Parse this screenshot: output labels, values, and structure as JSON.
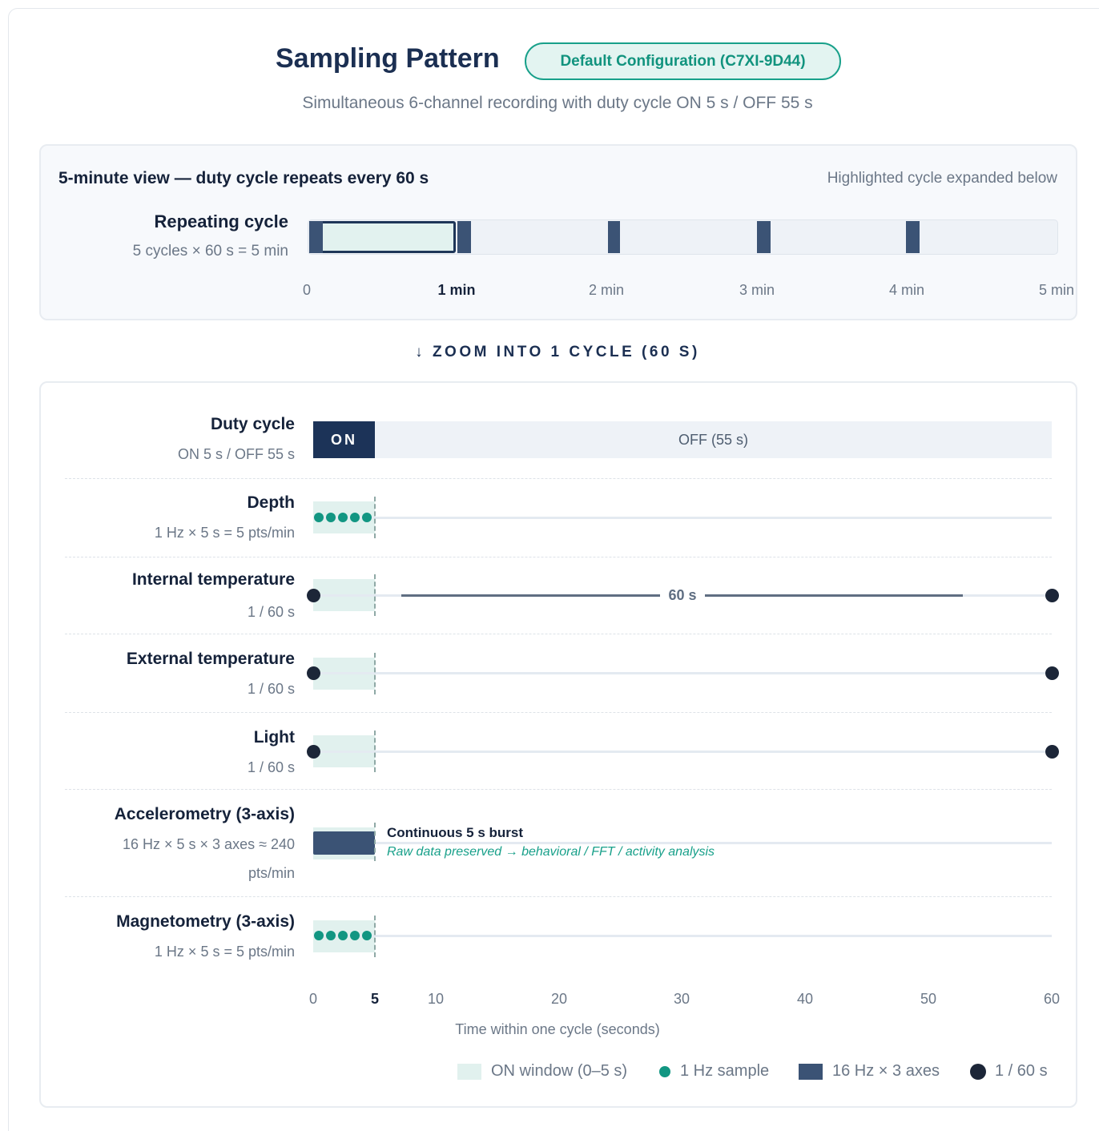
{
  "header": {
    "title": "Sampling Pattern",
    "badge": "Default Configuration (C7XI-9D44)",
    "subtitle": "Simultaneous 6-channel recording with duty cycle ON 5 s / OFF 55 s"
  },
  "overview": {
    "heading": "5-minute view — duty cycle repeats every 60 s",
    "note": "Highlighted cycle expanded below",
    "row_label": "Repeating cycle",
    "row_sub": "5 cycles × 60 s = 5 min",
    "ticks": [
      "0",
      "1 min",
      "2 min",
      "3 min",
      "4 min",
      "5 min"
    ]
  },
  "zoom_label": "↓ ZOOM INTO 1 CYCLE (60 S)",
  "rows": {
    "duty": {
      "name": "Duty cycle",
      "sub": "ON 5 s / OFF 55 s",
      "on_label": "ON",
      "off_label": "OFF (55 s)"
    },
    "depth": {
      "name": "Depth",
      "sub": "1 Hz × 5 s = 5 pts/min"
    },
    "internal_temp": {
      "name": "Internal temperature",
      "sub": "1 / 60 s",
      "span_label": "60 s"
    },
    "external_temp": {
      "name": "External temperature",
      "sub": "1 / 60 s"
    },
    "light": {
      "name": "Light",
      "sub": "1 / 60 s"
    },
    "accel": {
      "name": "Accelerometry (3-axis)",
      "sub_line1": "16 Hz × 5 s × 3 axes ≈ 240",
      "sub_line2": "pts/min",
      "burst_title": "Continuous 5 s burst",
      "burst_note": "Raw data preserved → behavioral / FFT / activity analysis"
    },
    "mag": {
      "name": "Magnetometry (3-axis)",
      "sub": "1 Hz × 5 s = 5 pts/min"
    }
  },
  "xaxis": {
    "ticks": [
      "0",
      "5",
      "10",
      "20",
      "30",
      "40",
      "50",
      "60"
    ],
    "label": "Time within one cycle (seconds)"
  },
  "legend": {
    "on_window": "ON window (0–5 s)",
    "hz_sample": "1 Hz sample",
    "burst": "16 Hz × 3 axes",
    "per60": "1 / 60 s"
  },
  "colors": {
    "navy": "#1c3358",
    "teal": "#129682",
    "slate": "#3b5375",
    "on_window": "#e1f1ee"
  }
}
